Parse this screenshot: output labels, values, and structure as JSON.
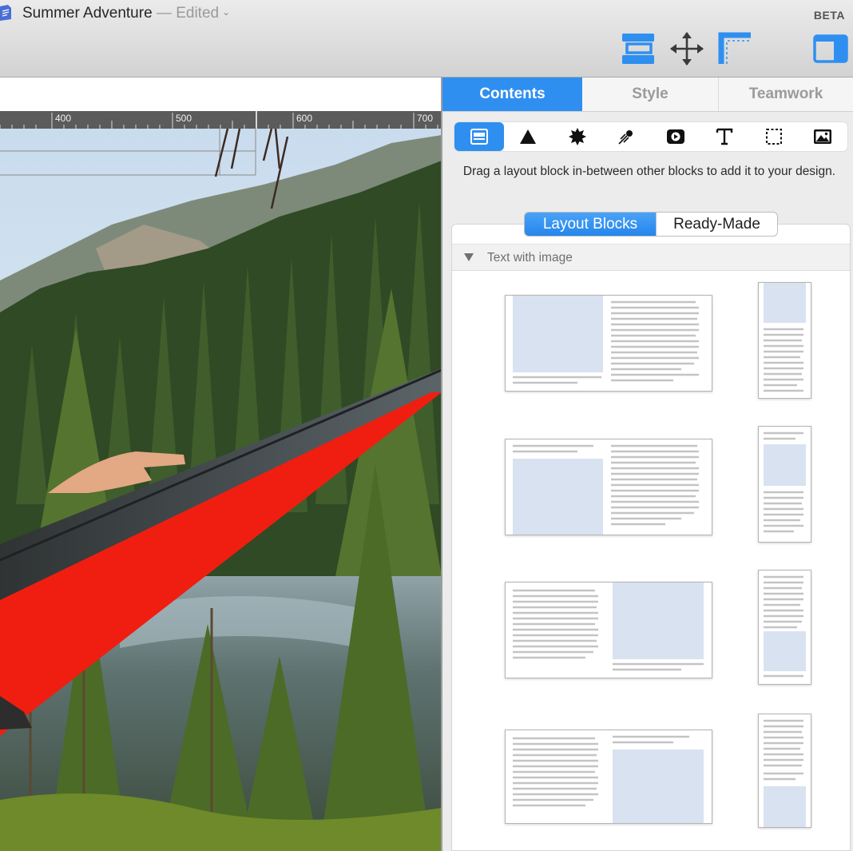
{
  "window": {
    "doc_name": "Summer Adventure",
    "separator": " — ",
    "status": "Edited",
    "badge": "BETA"
  },
  "toolbar": {
    "buttons": [
      {
        "icon": "layout-blocks-icon"
      },
      {
        "icon": "move-arrows-icon"
      },
      {
        "icon": "margins-icon"
      },
      {
        "icon": "sidebar-toggle-icon"
      }
    ]
  },
  "ruler": {
    "labels": [
      "400",
      "500",
      "600",
      "700"
    ]
  },
  "panel": {
    "tabs": [
      "Contents",
      "Style",
      "Teamwork"
    ],
    "active_tab": "Contents",
    "block_types": [
      "layout-block-icon",
      "shape-triangle-icon",
      "starburst-icon",
      "comet-icon",
      "video-icon",
      "text-icon",
      "selection-frame-icon",
      "image-icon"
    ],
    "hint": "Drag a layout block in-between other blocks to add it to your design.",
    "segments": [
      "Layout Blocks",
      "Ready-Made"
    ],
    "active_segment": "Layout Blocks",
    "section": "Text with image"
  },
  "colors": {
    "accent": "#2f8ff0",
    "hammock_red": "#f01e10",
    "placeholder_blue": "#b9cbe6"
  }
}
